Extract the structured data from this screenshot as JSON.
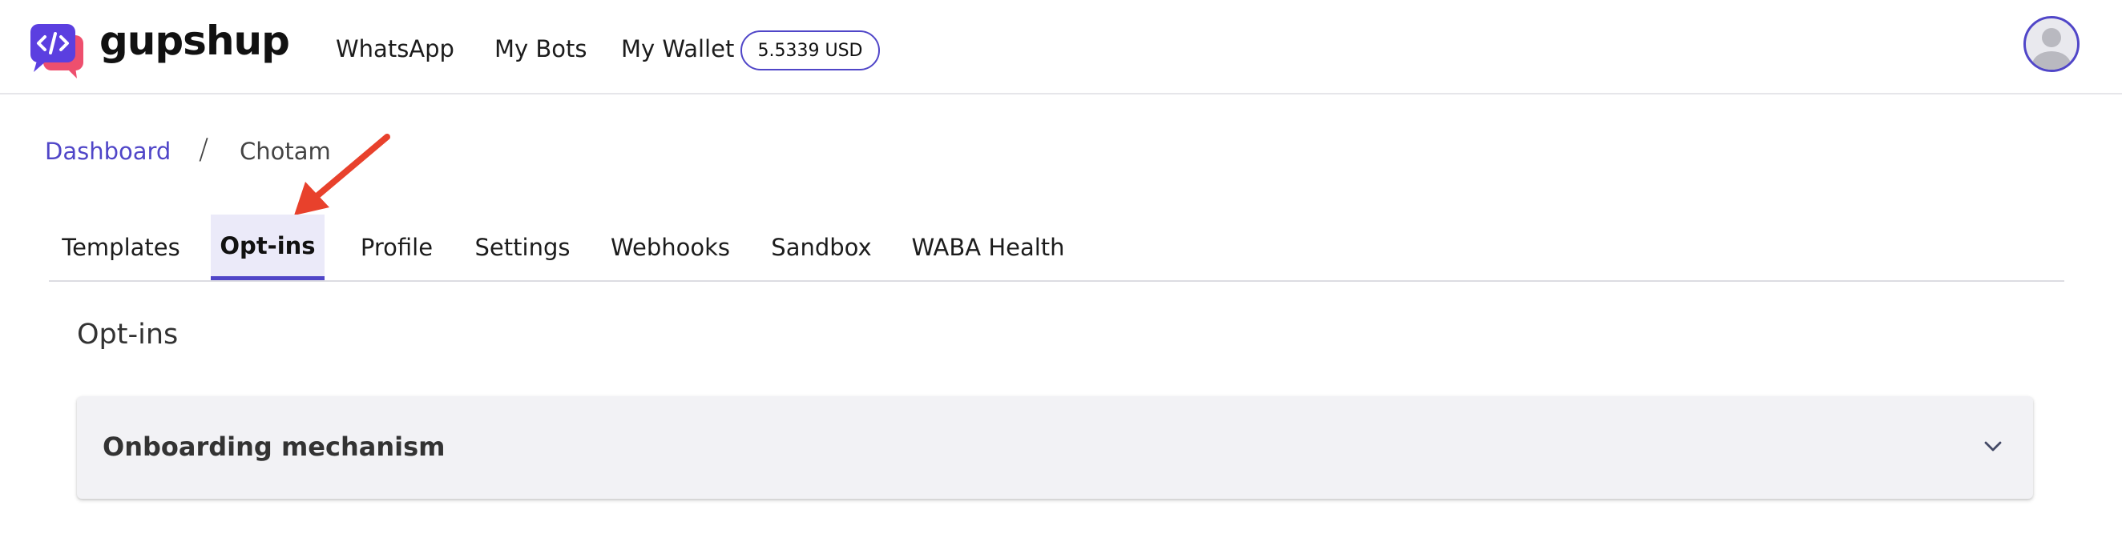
{
  "header": {
    "brand": "gupshup",
    "logo_icon": "code-chat-icon",
    "nav": [
      {
        "label": "WhatsApp"
      },
      {
        "label": "My Bots"
      },
      {
        "label": "My Wallet"
      }
    ],
    "wallet_balance": "5.5339 USD",
    "avatar_icon": "user-avatar-icon"
  },
  "breadcrumb": {
    "link": "Dashboard",
    "separator": "/",
    "current": "Chotam"
  },
  "tabs": [
    {
      "label": "Templates",
      "active": false
    },
    {
      "label": "Opt-ins",
      "active": true
    },
    {
      "label": "Profile",
      "active": false
    },
    {
      "label": "Settings",
      "active": false
    },
    {
      "label": "Webhooks",
      "active": false
    },
    {
      "label": "Sandbox",
      "active": false
    },
    {
      "label": "WABA Health",
      "active": false
    }
  ],
  "main": {
    "title": "Opt-ins",
    "accordion": {
      "title": "Onboarding mechanism",
      "icon": "chevron-down-icon"
    }
  },
  "colors": {
    "accent": "#5046c8",
    "active_tab_bg": "#ebeaf9",
    "annotation_arrow": "#e8412c",
    "logo_purple": "#5b3fe0",
    "logo_pink": "#ee4f6e"
  }
}
